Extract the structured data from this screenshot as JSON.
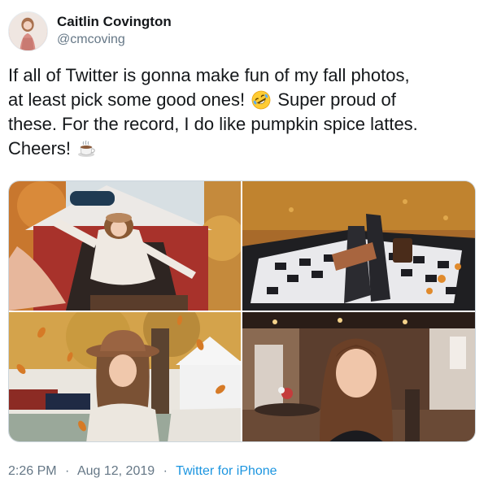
{
  "tweet": {
    "author": {
      "display_name": "Caitlin Covington",
      "handle": "@cmcoving"
    },
    "text_lines": [
      "If all of Twitter is gonna make fun of my fall photos,",
      "at least pick some good ones!",
      "Super proud of",
      "these. For the record, I do like pumpkin spice lattes.",
      "Cheers!"
    ],
    "emojis": [
      "rolling-on-floor-laughing-emoji",
      "hot-beverage-emoji"
    ],
    "photos": [
      {
        "description_icon": "covered-bridge-photo"
      },
      {
        "description_icon": "legs-on-checkered-blanket-photo"
      },
      {
        "description_icon": "hat-with-falling-leaves-photo"
      },
      {
        "description_icon": "restaurant-portrait-photo"
      }
    ],
    "time": "2:26 PM",
    "separator": "·",
    "date": "Aug 12, 2019",
    "source": "Twitter for iPhone"
  },
  "colors": {
    "text_primary": "#14171a",
    "text_secondary": "#657786",
    "link": "#1b95e0",
    "border": "#ccd6dd"
  }
}
